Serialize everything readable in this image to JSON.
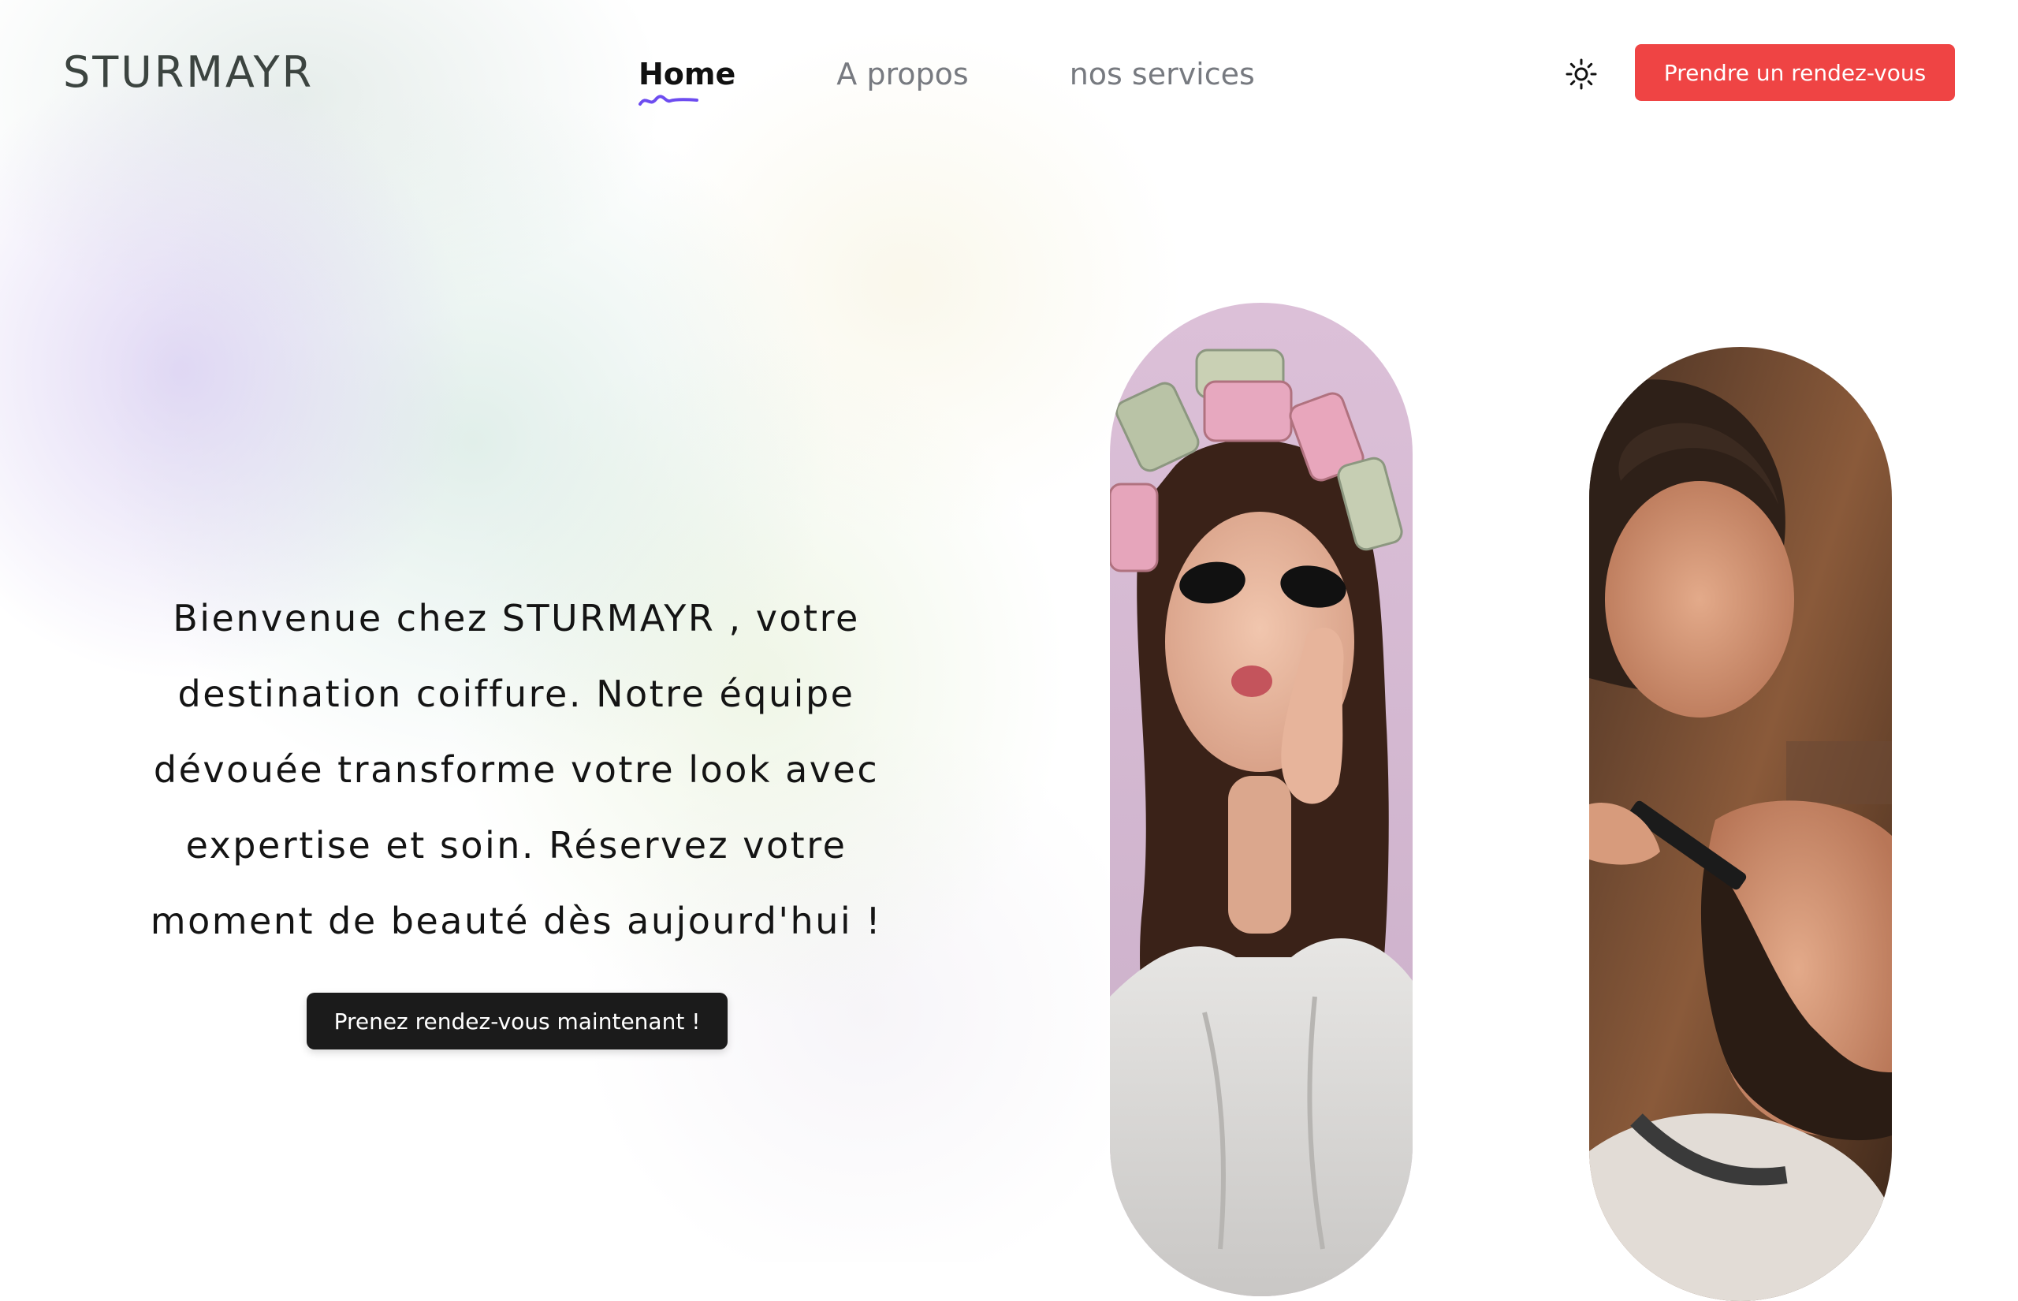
{
  "brand": {
    "logo_text": "STURMAYR"
  },
  "nav": {
    "items": [
      {
        "label": "Home",
        "active": true
      },
      {
        "label": "A propos",
        "active": false
      },
      {
        "label": "nos services",
        "active": false
      }
    ]
  },
  "header": {
    "theme_icon": "sun-icon",
    "cta_label": "Prendre un rendez-vous"
  },
  "hero": {
    "text": "Bienvenue chez STURMAYR , votre destination coiffure. Notre équipe dévouée transforme votre look avec expertise et soin. Réservez votre moment de beauté dès aujourd'hui !",
    "cta_label": "Prenez rendez-vous maintenant !"
  },
  "colors": {
    "accent_red": "#ef4444",
    "dark_button": "#1b1b1b",
    "nav_underline": "#6d4cf0"
  }
}
